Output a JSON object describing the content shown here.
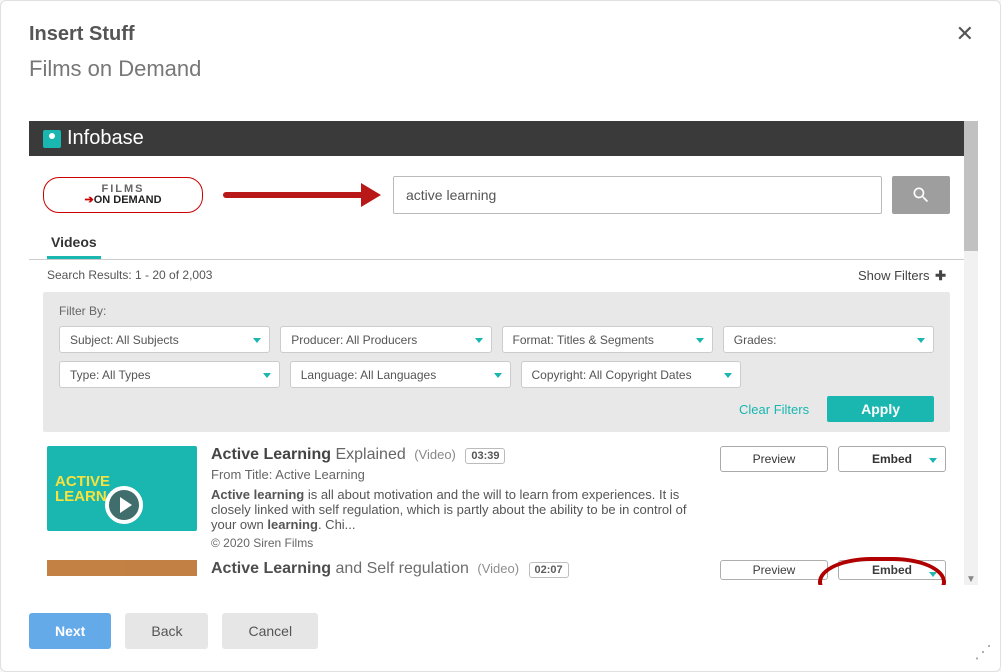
{
  "dialog": {
    "title": "Insert Stuff",
    "subtitle": "Films on Demand"
  },
  "brand": "Infobase",
  "fod_logo": {
    "line1": "FILMS",
    "line2_prefix": "➔",
    "line2": "ON DEMAND"
  },
  "search": {
    "value": "active learning"
  },
  "tabs": {
    "videos": "Videos"
  },
  "results_summary": "Search Results: 1 - 20 of 2,003",
  "show_filters": "Show Filters",
  "filters": {
    "label": "Filter By:",
    "subject": "Subject: All Subjects",
    "producer": "Producer: All Producers",
    "format": "Format: Titles & Segments",
    "grades": "Grades:",
    "type": "Type: All Types",
    "language": "Language: All Languages",
    "copyright": "Copyright: All Copyright Dates",
    "clear": "Clear Filters",
    "apply": "Apply"
  },
  "result1": {
    "thumb_text": "ACTIVE\nLEARN",
    "title_bold": "Active Learning",
    "title_light": " Explained",
    "title_meta": "(Video)",
    "duration": "03:39",
    "from_title": "From Title: Active Learning",
    "desc_pre": "Active learning",
    "desc_mid": " is all about motivation and the will to learn from experiences. It is closely linked with self regulation, which is partly about the ability to be in control of your own ",
    "desc_bold2": "learning",
    "desc_end": ". Chi...",
    "copyright": "© 2020 Siren Films",
    "preview": "Preview",
    "embed": "Embed"
  },
  "result2": {
    "title_bold": "Active Learning",
    "title_light": " and Self regulation",
    "title_meta": "(Video)",
    "duration": "02:07",
    "preview": "Preview",
    "embed": "Embed"
  },
  "footer": {
    "next": "Next",
    "back": "Back",
    "cancel": "Cancel"
  }
}
